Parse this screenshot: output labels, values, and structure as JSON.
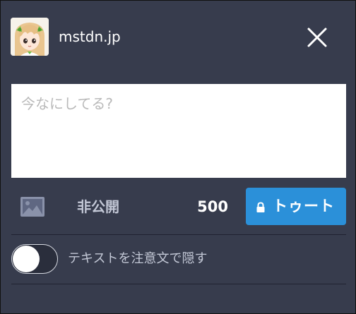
{
  "header": {
    "instance": "mstdn.jp",
    "avatar_icon": "avatar-image",
    "close_icon": "close-icon"
  },
  "compose": {
    "value": "",
    "placeholder": "今なにしてる?"
  },
  "toolbar": {
    "media_icon": "image-icon",
    "privacy_label": "非公開",
    "char_count": "500",
    "toot_label": "トゥート",
    "toot_icon": "lock-icon"
  },
  "content_warning": {
    "label": "テキストを注意文で隠す",
    "enabled": false
  },
  "colors": {
    "background": "#373c4d",
    "accent": "#2b90d9",
    "muted_text": "#c3c8d6",
    "placeholder": "#b9b9b9"
  }
}
